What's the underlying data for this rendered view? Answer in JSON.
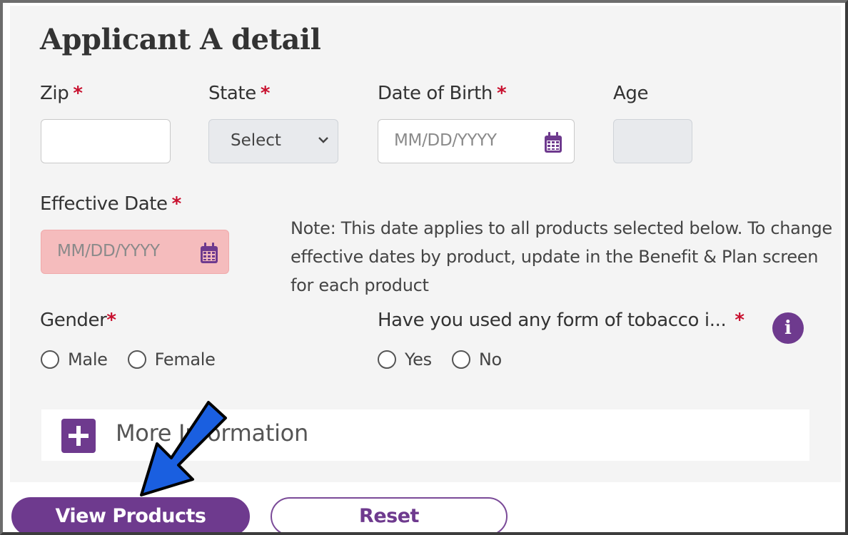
{
  "form": {
    "title": "Applicant A detail",
    "required_mark": "*",
    "zip": {
      "label": "Zip",
      "value": ""
    },
    "state": {
      "label": "State",
      "selected": "Select"
    },
    "dob": {
      "label": "Date of Birth",
      "placeholder": "MM/DD/YYYY"
    },
    "age": {
      "label": "Age",
      "value": ""
    },
    "effective_date": {
      "label": "Effective Date",
      "placeholder": "MM/DD/YYYY"
    },
    "note": "Note: This date applies to all products selected below. To change effective dates by product, update in the Benefit & Plan screen for each product",
    "gender": {
      "label": "Gender",
      "options": [
        "Male",
        "Female"
      ]
    },
    "tobacco": {
      "label": "Have you used any form of tobacco i...",
      "options": [
        "Yes",
        "No"
      ]
    },
    "more_info_label": "More Information"
  },
  "buttons": {
    "view_products": "View Products",
    "reset": "Reset"
  },
  "colors": {
    "accent": "#6e3a8e",
    "required": "#c8102e",
    "error_field": "#f5bcbd",
    "panel": "#f4f4f4",
    "annotation_arrow": "#1a5fe0"
  },
  "icons": [
    "calendar-icon",
    "chevron-down-icon",
    "info-icon",
    "plus-icon",
    "annotation-arrow"
  ]
}
